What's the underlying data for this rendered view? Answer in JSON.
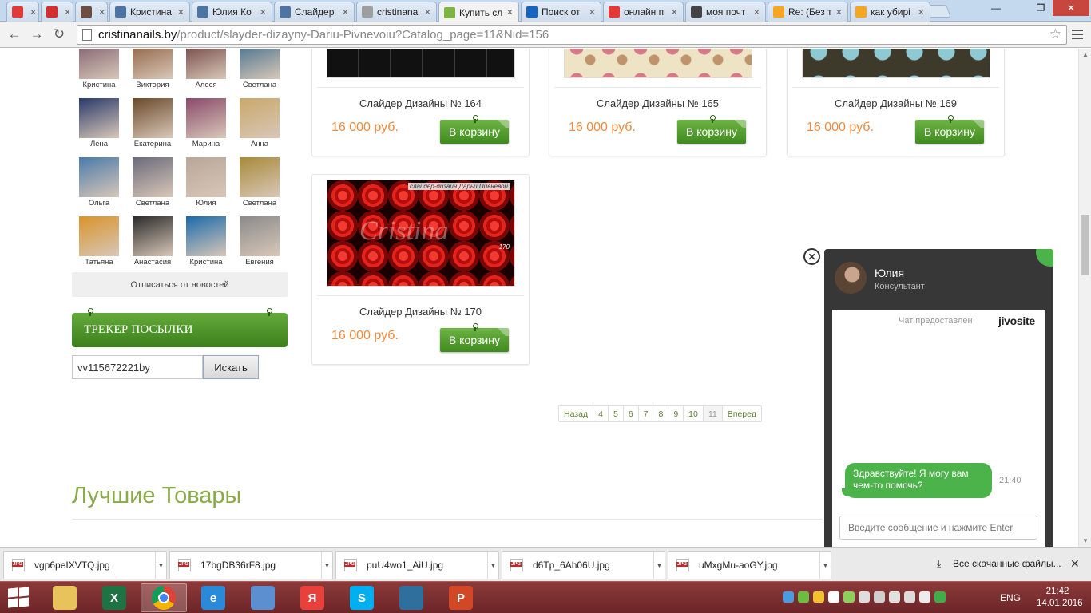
{
  "browser": {
    "tabs": [
      {
        "title": "",
        "icon": "app-icon",
        "color": "#e23a3a"
      },
      {
        "title": "",
        "icon": "copyright-icon",
        "color": "#d32f2f"
      },
      {
        "title": "",
        "icon": "instagram-icon",
        "color": "#6d4c41"
      },
      {
        "title": "Кристина",
        "icon": "vk-icon",
        "color": "#4c75a3"
      },
      {
        "title": "Юлия Ко",
        "icon": "vk-icon",
        "color": "#4c75a3"
      },
      {
        "title": "Слайдер",
        "icon": "vk-icon",
        "color": "#4c75a3"
      },
      {
        "title": "cristinana",
        "icon": "page-icon",
        "color": "#9e9e9e"
      },
      {
        "title": "Купить сл",
        "icon": "leaf-icon",
        "color": "#7cb342"
      },
      {
        "title": "Поиск от",
        "icon": "mail-icon",
        "color": "#1565c0"
      },
      {
        "title": "онлайн п",
        "icon": "yandex-icon",
        "color": "#e53935"
      },
      {
        "title": "моя почт",
        "icon": "search-icon",
        "color": "#444444"
      },
      {
        "title": "Re: (Без т",
        "icon": "mailru-icon",
        "color": "#f5a623"
      },
      {
        "title": "как убирі",
        "icon": "mailru-icon",
        "color": "#f5a623"
      }
    ],
    "url_host": "cristinanails.by",
    "url_path": "/product/slayder-dizayny-Dariu-Pivnevoiu?Catalog_page=11&Nid=156"
  },
  "sidebar": {
    "friends": [
      {
        "name": "Кристина",
        "color": "#7a5a6a"
      },
      {
        "name": "Виктория",
        "color": "#8a5a3a"
      },
      {
        "name": "Алеся",
        "color": "#6a3a3a"
      },
      {
        "name": "Светлана",
        "color": "#3a6a8a"
      },
      {
        "name": "Лена",
        "color": "#2a3a6a"
      },
      {
        "name": "Екатерина",
        "color": "#6a4a2a"
      },
      {
        "name": "Марина",
        "color": "#8a4a6a"
      },
      {
        "name": "Анна",
        "color": "#c9a86a"
      },
      {
        "name": "Ольга",
        "color": "#4a7aaa"
      },
      {
        "name": "Светлана",
        "color": "#6a6a7a"
      },
      {
        "name": "Юлия",
        "color": "#b9a69a"
      },
      {
        "name": "Светлана",
        "color": "#a88a3a"
      },
      {
        "name": "Татьяна",
        "color": "#d9932a"
      },
      {
        "name": "Анастасия",
        "color": "#2a2a2a"
      },
      {
        "name": "Кристина",
        "color": "#1a6aaa"
      },
      {
        "name": "Евгения",
        "color": "#8a8a8a"
      }
    ],
    "unsubscribe": "Отписаться от новостей",
    "tracker_title": "ТРЕКЕР ПОСЫЛКИ",
    "tracker_value": "vv115672221by",
    "tracker_button": "Искать"
  },
  "products": [
    {
      "title": "Слайдер Дизайны № 164",
      "price": "16 000 руб.",
      "buy": "В корзину",
      "pattern": "black"
    },
    {
      "title": "Слайдер Дизайны № 165",
      "price": "16 000 руб.",
      "buy": "В корзину",
      "pattern": "flower"
    },
    {
      "title": "Слайдер Дизайны № 169",
      "price": "16 000 руб.",
      "buy": "В корзину",
      "pattern": "damask"
    },
    {
      "title": "Слайдер Дизайны № 170",
      "price": "16 000 руб.",
      "buy": "В корзину",
      "pattern": "roses",
      "watermark": "Cristina",
      "caption": "слайдер-дизайн Дарьи Пивневой",
      "num": "170"
    }
  ],
  "pagination": {
    "prev": "Назад",
    "pages": [
      "4",
      "5",
      "6",
      "7",
      "8",
      "9",
      "10",
      "11"
    ],
    "current": "11",
    "next": "Вперед"
  },
  "section_title": "Лучшие Товары",
  "chat": {
    "operator_name": "Юлия",
    "operator_role": "Консультант",
    "provided_by": "Чат предоставлен",
    "brand": "jivosite",
    "message": "Здравствуйте! Я могу вам чем-то помочь?",
    "time": "21:40",
    "input_placeholder": "Введите сообщение и нажмите Enter",
    "accent": "#4cb34a"
  },
  "downloads": {
    "files": [
      "vgp6peIXVTQ.jpg",
      "17bgDB36rF8.jpg",
      "puU4wo1_AiU.jpg",
      "d6Tp_6Ah06U.jpg",
      "uMxgMu-aoGY.jpg"
    ],
    "show_all": "Все скачанные файлы..."
  },
  "taskbar": {
    "apps": [
      {
        "name": "explorer",
        "color": "#e8c25a",
        "glyph": ""
      },
      {
        "name": "excel",
        "color": "#1f7244",
        "glyph": "X"
      },
      {
        "name": "chrome",
        "color": "#e0e0e0",
        "glyph": ""
      },
      {
        "name": "ie",
        "color": "#2a8ad8",
        "glyph": "e"
      },
      {
        "name": "speaker",
        "color": "#5b8fd0",
        "glyph": ""
      },
      {
        "name": "yandex",
        "color": "#e8403a",
        "glyph": "Я"
      },
      {
        "name": "skype",
        "color": "#00aff0",
        "glyph": "S"
      },
      {
        "name": "photos",
        "color": "#2e6f9e",
        "glyph": ""
      },
      {
        "name": "powerpoint",
        "color": "#d24726",
        "glyph": "P"
      }
    ],
    "language": "ENG",
    "time": "21:42",
    "date": "14.01.2016"
  }
}
